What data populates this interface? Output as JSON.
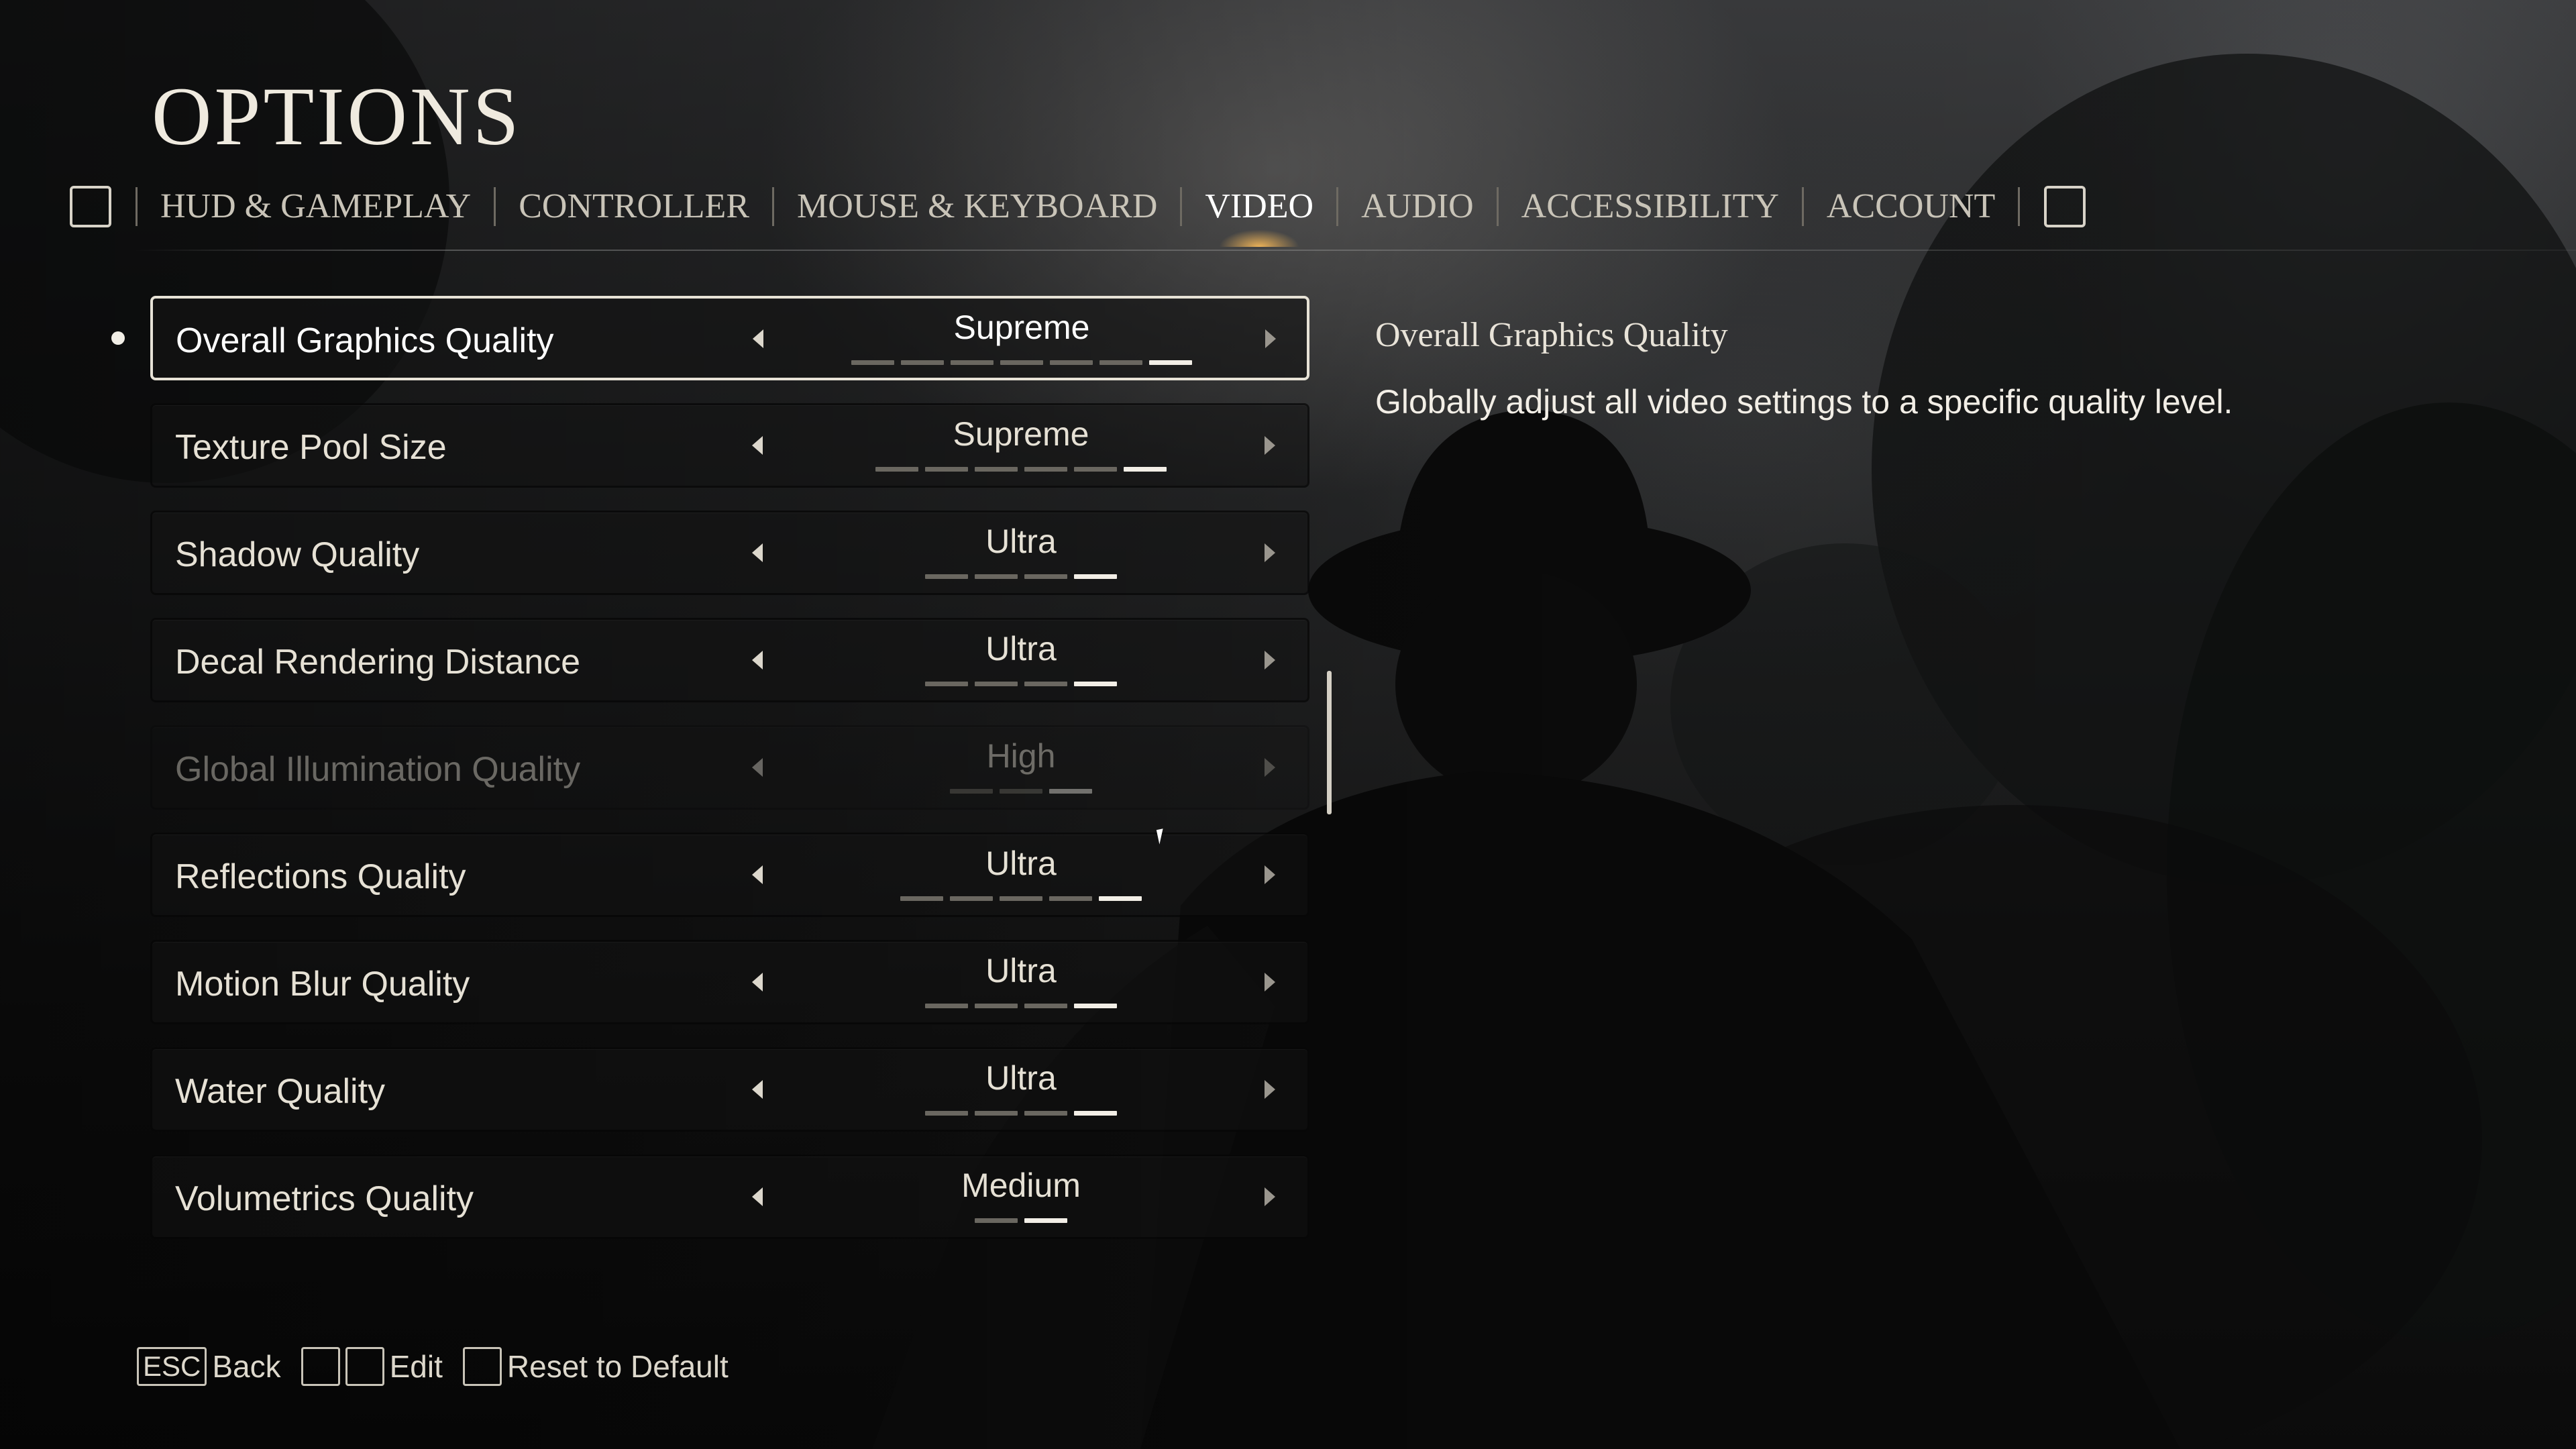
{
  "page": {
    "title": "OPTIONS"
  },
  "tabs": [
    {
      "label": "HUD & GAMEPLAY"
    },
    {
      "label": "CONTROLLER"
    },
    {
      "label": "MOUSE & KEYBOARD"
    },
    {
      "label": "VIDEO",
      "active": true
    },
    {
      "label": "AUDIO"
    },
    {
      "label": "ACCESSIBILITY"
    },
    {
      "label": "ACCOUNT"
    }
  ],
  "settings": [
    {
      "label": "Overall Graphics Quality",
      "value": "Supreme",
      "level": 7,
      "of": 7,
      "selected": true,
      "disabled": false
    },
    {
      "label": "Texture Pool Size",
      "value": "Supreme",
      "level": 6,
      "of": 6,
      "selected": false,
      "disabled": false
    },
    {
      "label": "Shadow Quality",
      "value": "Ultra",
      "level": 4,
      "of": 4,
      "selected": false,
      "disabled": false
    },
    {
      "label": "Decal Rendering Distance",
      "value": "Ultra",
      "level": 4,
      "of": 4,
      "selected": false,
      "disabled": false
    },
    {
      "label": "Global Illumination Quality",
      "value": "High",
      "level": 3,
      "of": 3,
      "selected": false,
      "disabled": true
    },
    {
      "label": "Reflections Quality",
      "value": "Ultra",
      "level": 5,
      "of": 5,
      "selected": false,
      "disabled": false
    },
    {
      "label": "Motion Blur Quality",
      "value": "Ultra",
      "level": 4,
      "of": 4,
      "selected": false,
      "disabled": false
    },
    {
      "label": "Water Quality",
      "value": "Ultra",
      "level": 4,
      "of": 4,
      "selected": false,
      "disabled": false
    },
    {
      "label": "Volumetrics Quality",
      "value": "Medium",
      "level": 2,
      "of": 2,
      "selected": false,
      "disabled": false
    }
  ],
  "description": {
    "title": "Overall Graphics Quality",
    "text": "Globally adjust all video settings to a specific quality level."
  },
  "footer": {
    "back_key": "ESC",
    "back_label": "Back",
    "edit_label": "Edit",
    "reset_label": "Reset to Default"
  },
  "colors": {
    "text": "#e8e4da",
    "selected_border": "#e7e2d6",
    "pip_on": "#f2eee6",
    "pip_off": "#6a6760",
    "tab_glow": "#ffbe5a"
  }
}
